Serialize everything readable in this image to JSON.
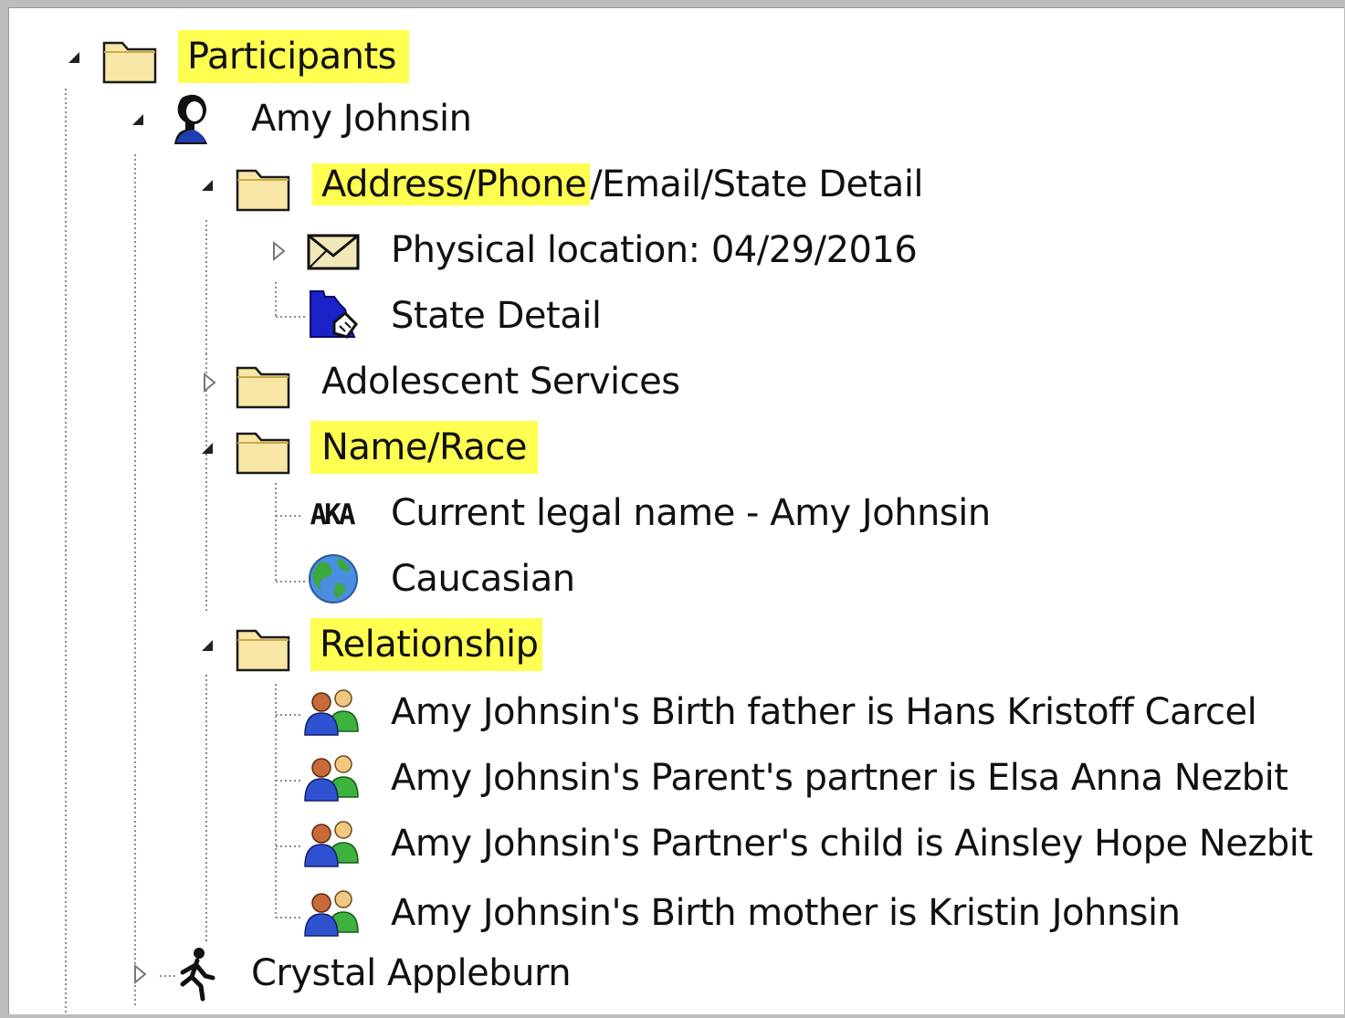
{
  "tree": {
    "root": {
      "label": "Participants",
      "expanded": true,
      "highlighted": true,
      "icon": "folder-icon"
    },
    "participants": [
      {
        "name": "Amy Johnsin",
        "icon": "female-person-icon",
        "expanded": true,
        "folders": [
          {
            "label_highlight": "Address/Phone",
            "label_rest": "/Email/State Detail",
            "expanded": true,
            "items": [
              {
                "label": "Physical location:  04/29/2016",
                "icon": "envelope-icon",
                "expandable": true
              },
              {
                "label": "State Detail",
                "icon": "state-map-icon"
              }
            ]
          },
          {
            "label": "Adolescent Services",
            "expanded": false
          },
          {
            "label": "Name/Race",
            "highlighted": true,
            "expanded": true,
            "items": [
              {
                "label": "Current legal name - Amy Johnsin",
                "icon_text": "AKA"
              },
              {
                "label": "Caucasian",
                "icon": "globe-icon"
              }
            ]
          },
          {
            "label": "Relationship",
            "highlighted": true,
            "expanded": true,
            "items": [
              {
                "label": "Amy Johnsin's Birth father is Hans Kristoff Carcel",
                "icon": "people-pair-icon"
              },
              {
                "label": "Amy Johnsin's Parent's partner is Elsa Anna Nezbit",
                "icon": "people-pair-icon"
              },
              {
                "label": "Amy Johnsin's Partner's child is Ainsley Hope Nezbit",
                "icon": "people-pair-icon"
              },
              {
                "label": "Amy Johnsin's Birth mother is Kristin Johnsin",
                "icon": "people-pair-icon"
              }
            ]
          }
        ]
      },
      {
        "name": "Crystal Appleburn",
        "icon": "walking-person-icon",
        "expanded": false
      }
    ]
  },
  "colors": {
    "highlight": "#ffff52",
    "folder_fill": "#f7e6a6",
    "folder_stroke": "#1a1a1a"
  }
}
